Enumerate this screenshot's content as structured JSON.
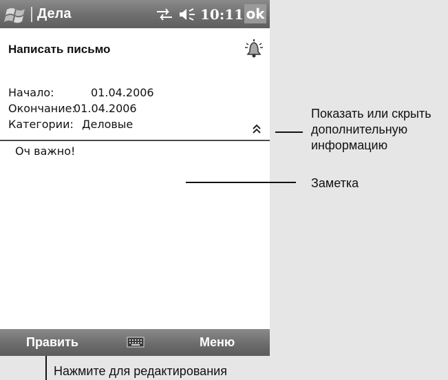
{
  "titlebar": {
    "app_title": "Дела",
    "clock": "10:11",
    "ok_label": "ok",
    "start_icon": "windows-flag-icon",
    "connectivity_icon": "connection-arrows-icon",
    "volume_icon": "speaker-icon"
  },
  "task": {
    "subject": "Написать письмо",
    "reminder_icon": "bell-icon",
    "fields": [
      {
        "label": "Начало:",
        "value": "01.04.2006"
      },
      {
        "label": "Окончание:",
        "value": "01.04.2006"
      },
      {
        "label": "Категории:",
        "value": "Деловые"
      }
    ],
    "collapse_glyph": "⌃",
    "note": "Оч важно!"
  },
  "menubar": {
    "edit_label": "Править",
    "menu_label": "Меню",
    "keyboard_icon": "keyboard-icon"
  },
  "callouts": {
    "toggle_info": "Показать или скрыть дополнительную информацию",
    "note": "Заметка",
    "edit": "Нажмите для редактирования"
  }
}
